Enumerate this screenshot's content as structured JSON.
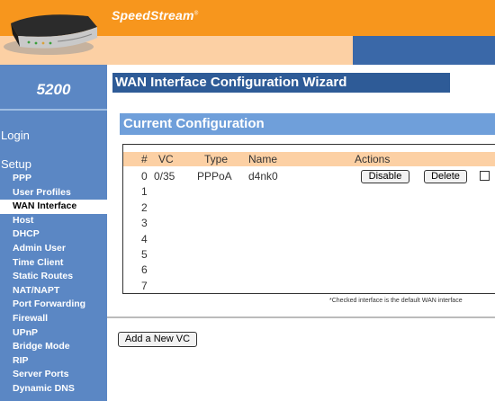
{
  "header": {
    "brand": "SpeedStream",
    "brand_mark": "®",
    "colors": {
      "orange": "#f7961d",
      "peach": "#fcd0a4",
      "blue": "#3a68a8"
    }
  },
  "sidebar": {
    "model": "5200",
    "login": "Login",
    "setup": "Setup",
    "items": [
      {
        "label": "PPP"
      },
      {
        "label": "User Profiles"
      },
      {
        "label": "WAN Interface",
        "active": true
      },
      {
        "label": "Host"
      },
      {
        "label": "DHCP"
      },
      {
        "label": "Admin User"
      },
      {
        "label": "Time Client"
      },
      {
        "label": "Static Routes"
      },
      {
        "label": "NAT/NAPT"
      },
      {
        "label": "Port Forwarding"
      },
      {
        "label": "Firewall"
      },
      {
        "label": "UPnP"
      },
      {
        "label": "Bridge Mode"
      },
      {
        "label": "RIP"
      },
      {
        "label": "Server Ports"
      },
      {
        "label": "Dynamic DNS"
      }
    ]
  },
  "main": {
    "title": "WAN Interface Configuration Wizard",
    "section_title": "Current Configuration",
    "table": {
      "headers": {
        "num": "#",
        "vc": "VC",
        "type": "Type",
        "name": "Name",
        "actions": "Actions"
      },
      "first_row": {
        "num": "0",
        "vc": "0/35",
        "type": "PPPoA",
        "name": "d4nk0",
        "disable": "Disable",
        "delete": "Delete",
        "default_checked": false
      },
      "empty_rows": [
        "1",
        "2",
        "3",
        "4",
        "5",
        "6",
        "7"
      ]
    },
    "note": "*Checked interface is the default WAN interface",
    "add_button": "Add a New VC"
  }
}
